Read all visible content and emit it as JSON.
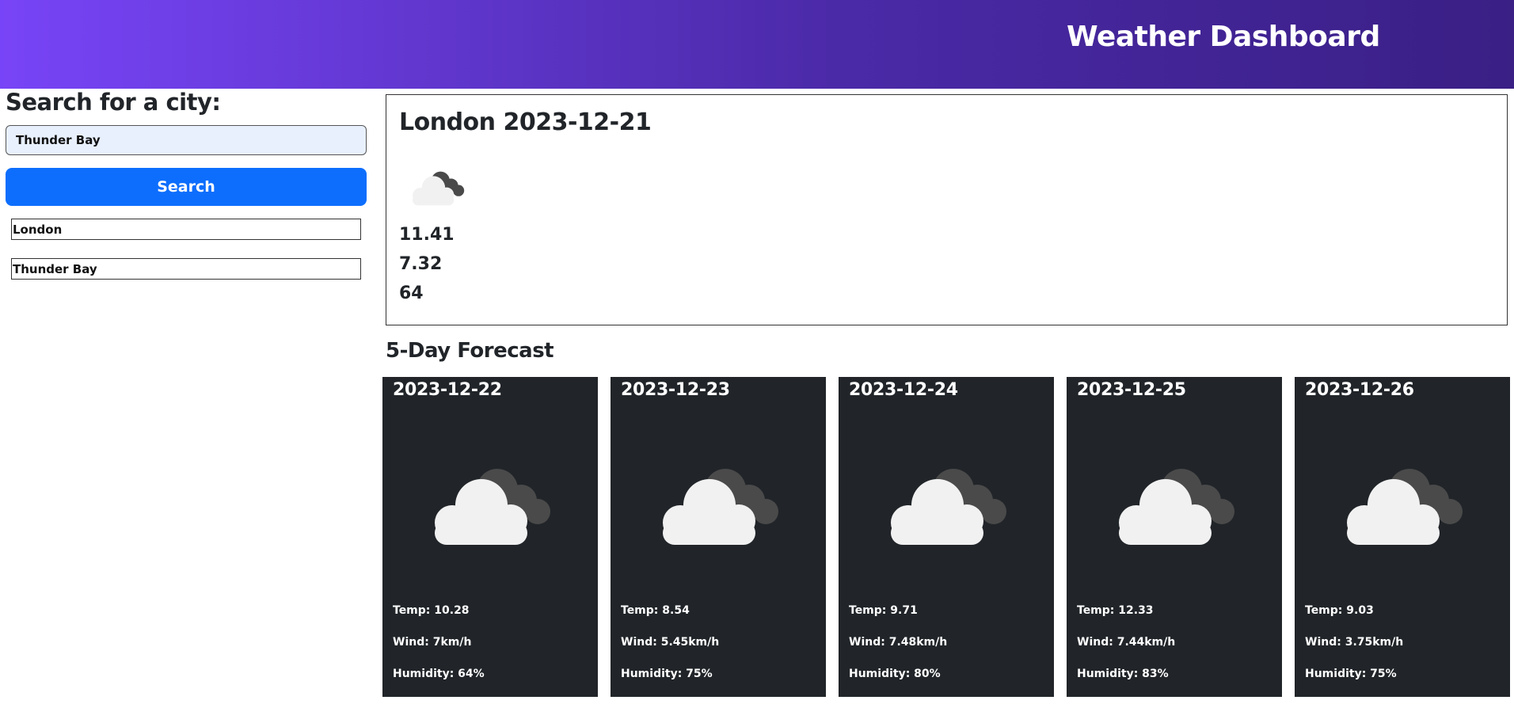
{
  "header": {
    "title": "Weather Dashboard"
  },
  "sidebar": {
    "title": "Search for a city:",
    "search_value": "Thunder Bay",
    "search_button": "Search",
    "history": [
      "London",
      "Thunder Bay"
    ]
  },
  "current": {
    "title": "London 2023-12-21",
    "icon": "partly-cloudy-icon",
    "values": [
      "11.41",
      "7.32",
      "64"
    ]
  },
  "forecast": {
    "title": "5-Day Forecast",
    "days": [
      {
        "date": "2023-12-22",
        "icon": "partly-cloudy-icon",
        "temp": "Temp: 10.28",
        "wind": "Wind: 7km/h",
        "humidity": "Humidity: 64%"
      },
      {
        "date": "2023-12-23",
        "icon": "partly-cloudy-icon",
        "temp": "Temp: 8.54",
        "wind": "Wind: 5.45km/h",
        "humidity": "Humidity: 75%"
      },
      {
        "date": "2023-12-24",
        "icon": "partly-cloudy-icon",
        "temp": "Temp: 9.71",
        "wind": "Wind: 7.48km/h",
        "humidity": "Humidity: 80%"
      },
      {
        "date": "2023-12-25",
        "icon": "partly-cloudy-icon",
        "temp": "Temp: 12.33",
        "wind": "Wind: 7.44km/h",
        "humidity": "Humidity: 83%"
      },
      {
        "date": "2023-12-26",
        "icon": "partly-cloudy-icon",
        "temp": "Temp: 9.03",
        "wind": "Wind: 3.75km/h",
        "humidity": "Humidity: 75%"
      }
    ]
  },
  "colors": {
    "header_gradient_start": "#7844f7",
    "header_gradient_end": "#3a1f85",
    "search_button": "#0d6efd",
    "forecast_card": "#212529",
    "input_background": "#e8f0fe"
  }
}
